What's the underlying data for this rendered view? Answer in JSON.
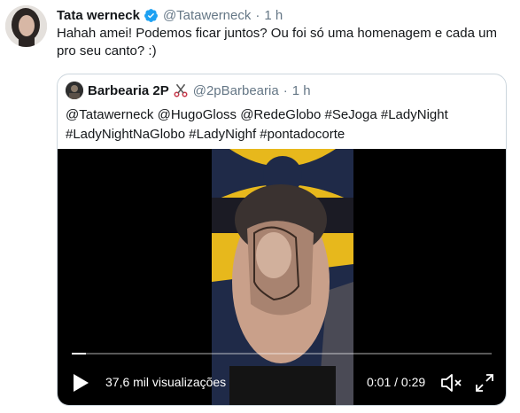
{
  "tweet": {
    "author_name": "Tata werneck",
    "author_handle": "@Tatawerneck",
    "separator": "·",
    "time": "1 h",
    "text": "Hahah amei! Podemos ficar juntos? Ou foi só uma homenagem e cada um pro seu canto? :)",
    "verified_icon": "verified-badge-icon"
  },
  "quoted": {
    "author_name": "Barbearia 2P",
    "emoji_icon": "scissors-icon",
    "author_handle": "@2pBarbearia",
    "separator": "·",
    "time": "1 h",
    "text": "@Tatawerneck @HugoGloss @RedeGlobo #SeJoga  #LadyNight #LadyNightNaGlobo #LadyNighf #pontadocorte"
  },
  "video": {
    "views": "37,6 mil visualizações",
    "time_display": "0:01 / 0:29",
    "progress_fraction": 0.034,
    "colors": {
      "wall": "#e7b81c",
      "track": "#ffffff"
    }
  }
}
